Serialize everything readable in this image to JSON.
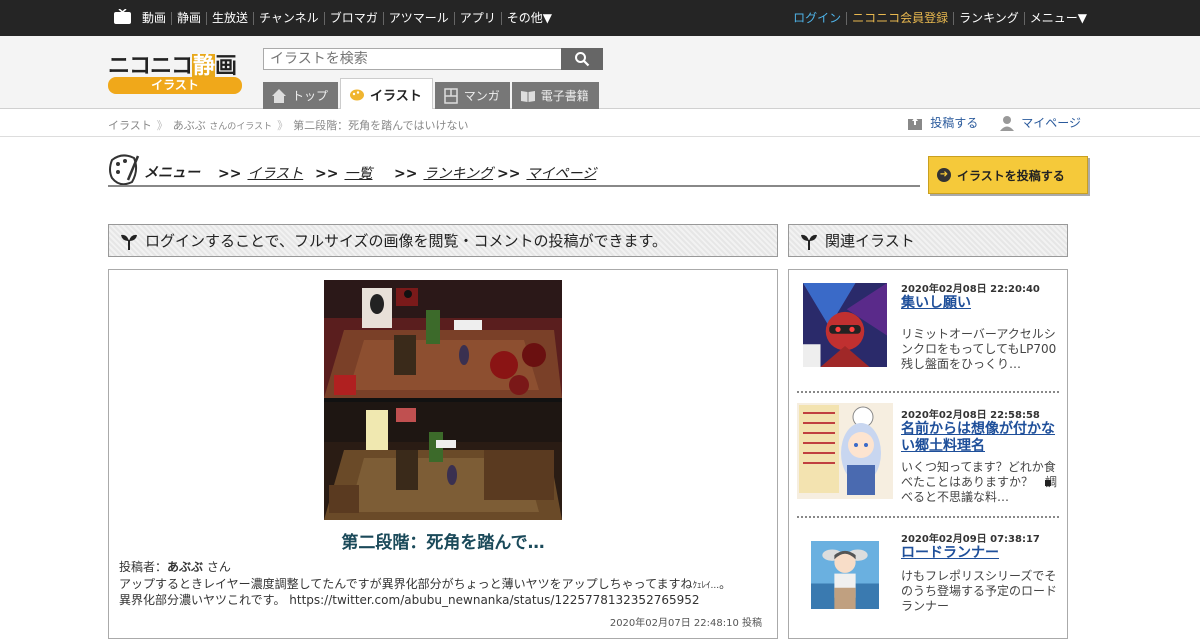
{
  "topbar": {
    "left_items": [
      "動画",
      "静画",
      "生放送",
      "チャンネル",
      "ブロマガ",
      "アツマール",
      "アプリ",
      "その他▼"
    ],
    "right_items": {
      "login": "ログイン",
      "register": "ニコニコ会員登録",
      "ranking": "ランキング",
      "menu": "メニュー▼"
    }
  },
  "header": {
    "logo_main_a": "ニコニコ",
    "logo_main_b": "静",
    "logo_main_c": "画",
    "logo_sub": "イラスト",
    "search_placeholder": "イラストを検索",
    "tabs": [
      {
        "label": "トップ",
        "icon": "house-icon",
        "active": false
      },
      {
        "label": "イラスト",
        "icon": "palette-icon",
        "active": true
      },
      {
        "label": "マンガ",
        "icon": "comic-icon",
        "active": false
      },
      {
        "label": "電子書籍",
        "icon": "book-icon",
        "active": false
      }
    ]
  },
  "breadcrumb": {
    "root": "イラスト",
    "user": "あぶぶ",
    "user_suffix": "さんのイラスト",
    "current": "第二段階：死角を踏んではいけない",
    "post_label": "投稿する",
    "mypage_label": "マイページ"
  },
  "menu": {
    "title": "メニュー",
    "links": [
      {
        "arrow": ">>",
        "label": "イラスト"
      },
      {
        "arrow": ">>",
        "label": "一覧"
      },
      {
        "arrow": ">>",
        "label": "ランキング"
      },
      {
        "arrow": ">>",
        "label": "マイページ"
      }
    ],
    "post_button": "イラストを投稿する"
  },
  "main": {
    "heading": "ログインすることで、フルサイズの画像を閲覧・コメントの投稿ができます。",
    "title": "第二段階：死角を踏んで…",
    "poster_label": "投稿者：",
    "poster_name": "あぶぶ",
    "poster_suffix": " さん",
    "description_1": "アップするときレイヤー濃度調整してたんですが異界化部分がちょっと薄いヤツをアップしちゃってますね",
    "description_small": "ｸｪﾚｲ...",
    "description_2": "。",
    "description_3": "異界化部分濃いヤツこれです。 https://twitter.com/abubu_newnanka/status/1225778132352765952",
    "posted_at": "2020年02月07日 22:48:10 投稿"
  },
  "sidebar": {
    "heading": "関連イラスト",
    "items": [
      {
        "date": "2020年02月08日 22:20:40",
        "title": "集いし願い",
        "desc": "リミットオーバーアクセルシンクロをもってしてもLP700残し盤面をひっくり…"
      },
      {
        "date": "2020年02月08日 22:58:58",
        "title": "名前からは想像が付かない郷土料理名",
        "desc": "いくつ知ってます？どれか食べたことはありますか？　調べると不思議な料…"
      },
      {
        "date": "2020年02月09日 07:38:17",
        "title": "ロードランナー",
        "desc": "けもフレポリスシリーズでそのうち登場する予定のロードランナー"
      }
    ]
  },
  "colors": {
    "topbar_bg": "#252525",
    "login": "#4fb3e8",
    "register": "#e8b84f",
    "logo_accent": "#f0a81a",
    "link_blue": "#1e4f9a",
    "title_teal": "#1b4a5a"
  }
}
